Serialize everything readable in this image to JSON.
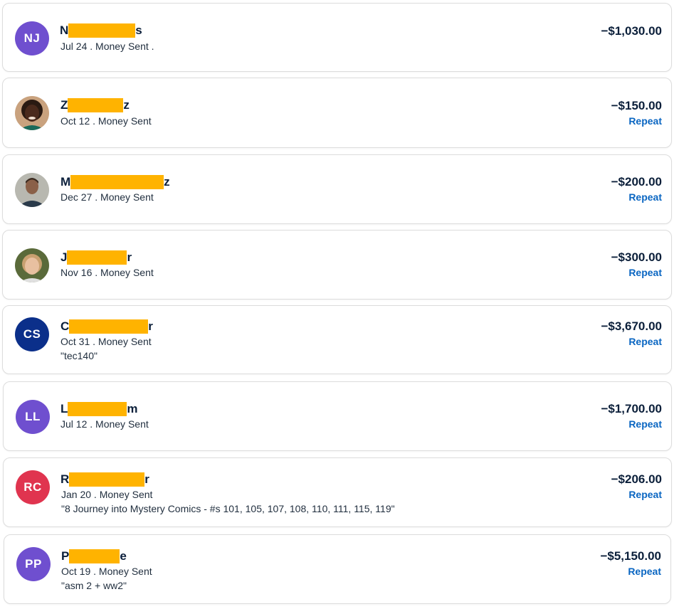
{
  "transactions": [
    {
      "initials": "NJ",
      "name_first": "N",
      "name_last": "s",
      "date": "Jul 24",
      "type": "Money Sent .",
      "amount": "−$1,030.00",
      "repeat": "",
      "note": "",
      "avatar_color": "#6f4fcf",
      "avatar_kind": "initials"
    },
    {
      "initials": "",
      "name_first": "Z",
      "name_last": "z",
      "date": "Oct 12",
      "type": "Money Sent",
      "amount": "−$150.00",
      "repeat": "Repeat",
      "note": "",
      "avatar_color": "#5a3a2a",
      "avatar_kind": "photo"
    },
    {
      "initials": "",
      "name_first": "M",
      "name_last": "z",
      "date": "Dec 27",
      "type": "Money Sent",
      "amount": "−$200.00",
      "repeat": "Repeat",
      "note": "",
      "avatar_color": "#8a8a8a",
      "avatar_kind": "photo"
    },
    {
      "initials": "",
      "name_first": "J",
      "name_last": "r",
      "date": "Nov 16",
      "type": "Money Sent",
      "amount": "−$300.00",
      "repeat": "Repeat",
      "note": "",
      "avatar_color": "#6b7a4a",
      "avatar_kind": "photo"
    },
    {
      "initials": "CS",
      "name_first": "C",
      "name_last": "r",
      "date": "Oct 31",
      "type": "Money Sent",
      "amount": "−$3,670.00",
      "repeat": "Repeat",
      "note": "\"tec140\"",
      "avatar_color": "#0b2f8a",
      "avatar_kind": "initials"
    },
    {
      "initials": "LL",
      "name_first": "L",
      "name_last": "m",
      "date": "Jul 12",
      "type": "Money Sent",
      "amount": "−$1,700.00",
      "repeat": "Repeat",
      "note": "",
      "avatar_color": "#6f4fcf",
      "avatar_kind": "initials"
    },
    {
      "initials": "RC",
      "name_first": "R",
      "name_last": "r",
      "date": "Jan 20",
      "type": "Money Sent",
      "amount": "−$206.00",
      "repeat": "Repeat",
      "note": "\"8 Journey into Mystery Comics - #s 101, 105, 107, 108, 110, 111, 115, 119\"",
      "avatar_color": "#e0344f",
      "avatar_kind": "initials"
    },
    {
      "initials": "PP",
      "name_first": "P",
      "name_last": "e",
      "date": "Oct 19",
      "type": "Money Sent",
      "amount": "−$5,150.00",
      "repeat": "Repeat",
      "note": "\"asm 2 + ww2\"",
      "avatar_color": "#6f4fcf",
      "avatar_kind": "initials"
    }
  ]
}
